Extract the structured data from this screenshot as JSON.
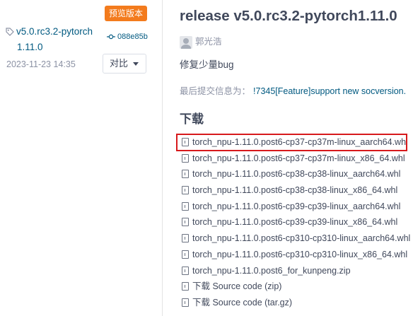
{
  "sidebar": {
    "prerelease_badge": "预览版本",
    "tag_line1": "v5.0.rc3.2-pytorch",
    "tag_line2": "1.11.0",
    "commit_hash": "088e85b",
    "date": "2023-11-23 14:35",
    "compare_label": "对比"
  },
  "release": {
    "title": "release v5.0.rc3.2-pytorch1.11.0",
    "author": "郭光浩",
    "description": "修复少量bug",
    "commit_info_label": "最后提交信息为：",
    "commit_info_link": "!7345[Feature]support new socversion."
  },
  "download": {
    "heading": "下载",
    "files": [
      "torch_npu-1.11.0.post6-cp37-cp37m-linux_aarch64.whl",
      "torch_npu-1.11.0.post6-cp37-cp37m-linux_x86_64.whl",
      "torch_npu-1.11.0.post6-cp38-cp38-linux_aarch64.whl",
      "torch_npu-1.11.0.post6-cp38-cp38-linux_x86_64.whl",
      "torch_npu-1.11.0.post6-cp39-cp39-linux_aarch64.whl",
      "torch_npu-1.11.0.post6-cp39-cp39-linux_x86_64.whl",
      "torch_npu-1.11.0.post6-cp310-cp310-linux_aarch64.whl",
      "torch_npu-1.11.0.post6-cp310-cp310-linux_x86_64.whl",
      "torch_npu-1.11.0.post6_for_kunpeng.zip",
      "下载 Source code (zip)",
      "下载 Source code (tar.gz)"
    ],
    "highlighted_index": 0
  },
  "colors": {
    "accent_badge": "#f37b1d",
    "link": "#005980",
    "highlight_border": "#d7191c"
  },
  "icons": [
    "tag-icon",
    "commit-icon",
    "caret-down-icon",
    "avatar",
    "file-icon"
  ]
}
